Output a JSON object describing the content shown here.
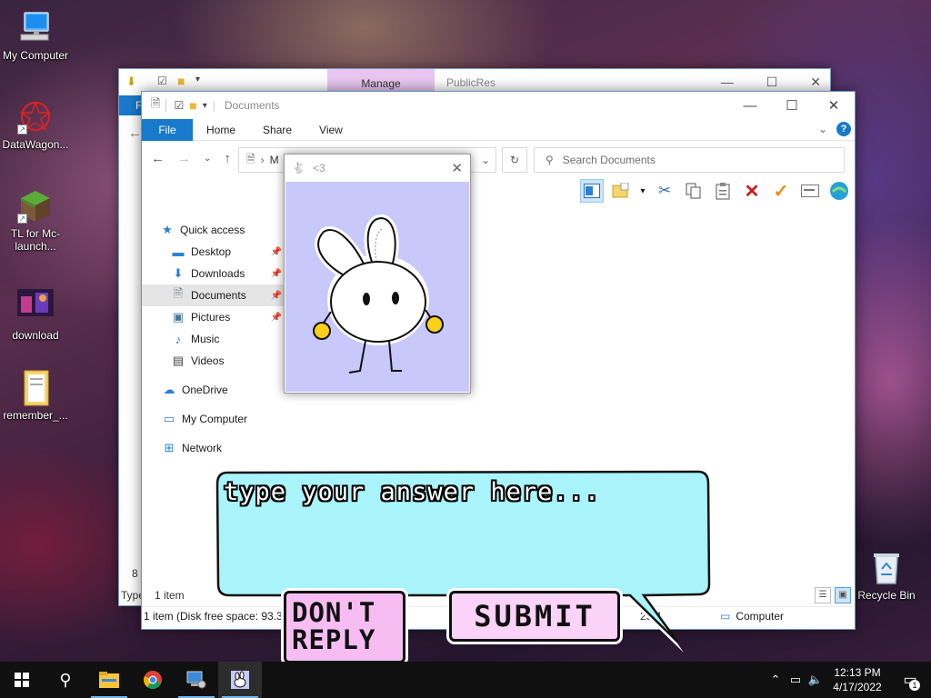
{
  "desktop": {
    "icons": [
      {
        "label": "My Computer"
      },
      {
        "label": "DataWagon..."
      },
      {
        "label": "TL for Mc-launch..."
      },
      {
        "label": "download"
      },
      {
        "label": "remember_..."
      },
      {
        "label": "Recycle Bin"
      }
    ]
  },
  "back_window": {
    "manage_tab": "Manage",
    "title": "PublicRes",
    "file_tab": "F",
    "status_count": "8 i",
    "status_type": "Type"
  },
  "explorer": {
    "title": "Documents",
    "tabs": [
      "File",
      "Home",
      "Share",
      "View"
    ],
    "address": "M",
    "search_placeholder": "Search Documents",
    "nav": {
      "quick_access": "Quick access",
      "desktop": "Desktop",
      "downloads": "Downloads",
      "documents": "Documents",
      "pictures": "Pictures",
      "music": "Music",
      "videos": "Videos",
      "onedrive": "OneDrive",
      "my_computer": "My Computer",
      "network": "Network"
    },
    "item_count": "1 item",
    "disk_status": "1 item (Disk free space: 93.3 G",
    "size_status": "25.4",
    "computer_label": "Computer"
  },
  "bunny_window": {
    "title": "<3"
  },
  "prompt": {
    "answer_placeholder": "type your answer here...",
    "dont_reply_label": "DON'T\nREPLY",
    "submit_label": "SUBMIT"
  },
  "taskbar": {
    "time": "12:13 PM",
    "date": "4/17/2022",
    "notification_count": "1"
  },
  "colors": {
    "accent": "#1979ca",
    "bubble": "#a8f4fa",
    "bunny_bg": "#c8c8fa",
    "button_pink": "#f7bdf3",
    "manage_tab": "#e8c6f0"
  }
}
